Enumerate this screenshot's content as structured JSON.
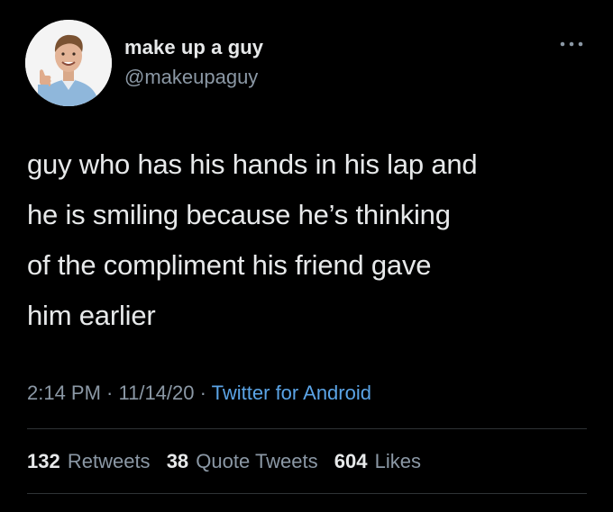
{
  "author": {
    "display_name": "make up a guy",
    "handle": "@makeupaguy",
    "avatar_icon": "person-thumbs-up-avatar"
  },
  "more_icon": "ellipsis-icon",
  "tweet": {
    "text": "guy who has his hands in his lap and\nhe is smiling because he’s thinking\nof the compliment his friend gave\nhim earlier"
  },
  "meta": {
    "time": "2:14 PM",
    "sep1": " · ",
    "date": "11/14/20",
    "sep2": " · ",
    "source": "Twitter for Android"
  },
  "stats": {
    "retweets": {
      "count": "132",
      "label": "Retweets"
    },
    "quotes": {
      "count": "38",
      "label": "Quote Tweets"
    },
    "likes": {
      "count": "604",
      "label": "Likes"
    }
  },
  "colors": {
    "background": "#000000",
    "primary_text": "#e7e9ea",
    "secondary_text": "#8b98a5",
    "link": "#5ba4e6",
    "divider": "#2f3336"
  }
}
